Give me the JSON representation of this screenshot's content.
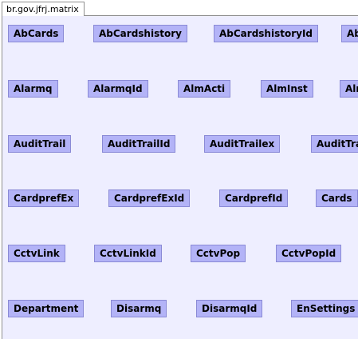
{
  "tab": {
    "label": "br.gov.jfrj.matrix"
  },
  "rows": [
    {
      "items": [
        "AbCards",
        "AbCardshistory",
        "AbCardshistoryId",
        "AbCardsId"
      ]
    },
    {
      "items": [
        "Alarmq",
        "AlarmqId",
        "AlmActi",
        "AlmInst",
        "AlmInstId"
      ]
    },
    {
      "items": [
        "AuditTrail",
        "AuditTrailId",
        "AuditTrailex",
        "AuditTrailexId"
      ]
    },
    {
      "items": [
        "CardprefEx",
        "CardprefExId",
        "CardprefId",
        "Cards"
      ]
    },
    {
      "items": [
        "CctvLink",
        "CctvLinkId",
        "CctvPop",
        "CctvPopId"
      ]
    },
    {
      "items": [
        "Department",
        "Disarmq",
        "DisarmqId",
        "EnSettings"
      ]
    }
  ]
}
